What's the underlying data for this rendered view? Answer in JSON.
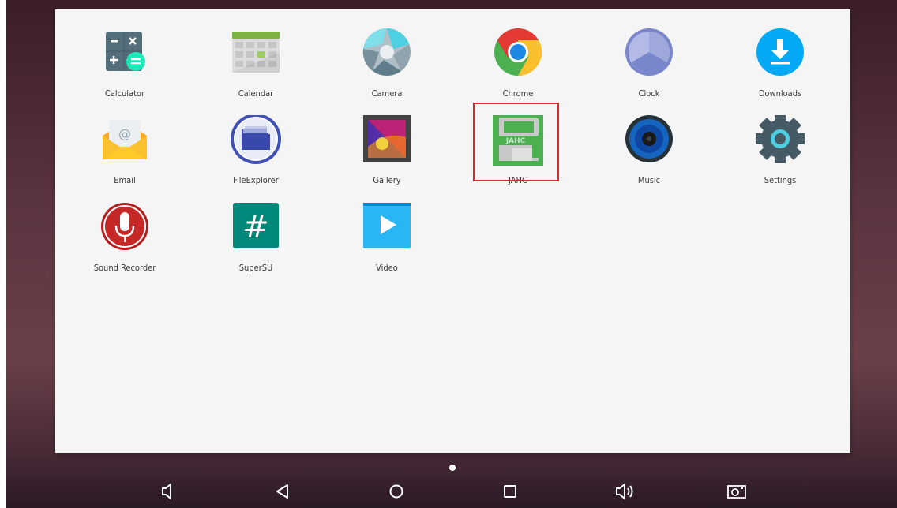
{
  "apps": [
    {
      "label": "Calculator",
      "icon": "calculator-icon"
    },
    {
      "label": "Calendar",
      "icon": "calendar-icon"
    },
    {
      "label": "Camera",
      "icon": "camera-icon"
    },
    {
      "label": "Chrome",
      "icon": "chrome-icon"
    },
    {
      "label": "Clock",
      "icon": "clock-icon"
    },
    {
      "label": "Downloads",
      "icon": "downloads-icon"
    },
    {
      "label": "Email",
      "icon": "email-icon"
    },
    {
      "label": "FileExplorer",
      "icon": "file-explorer-icon"
    },
    {
      "label": "Gallery",
      "icon": "gallery-icon"
    },
    {
      "label": "JAHC",
      "icon": "jahc-icon",
      "icon_text": "JAHC",
      "highlighted": true
    },
    {
      "label": "Music",
      "icon": "music-icon"
    },
    {
      "label": "Settings",
      "icon": "settings-icon"
    },
    {
      "label": "Sound Recorder",
      "icon": "sound-recorder-icon"
    },
    {
      "label": "SuperSU",
      "icon": "supersu-icon",
      "icon_text": "#"
    },
    {
      "label": "Video",
      "icon": "video-icon"
    }
  ],
  "highlight_color": "#d9252b",
  "nav_bar": {
    "buttons": [
      "volume-down-icon",
      "back-icon",
      "home-icon",
      "recents-icon",
      "volume-up-icon",
      "screenshot-icon"
    ],
    "page_indicator_count": 1
  }
}
